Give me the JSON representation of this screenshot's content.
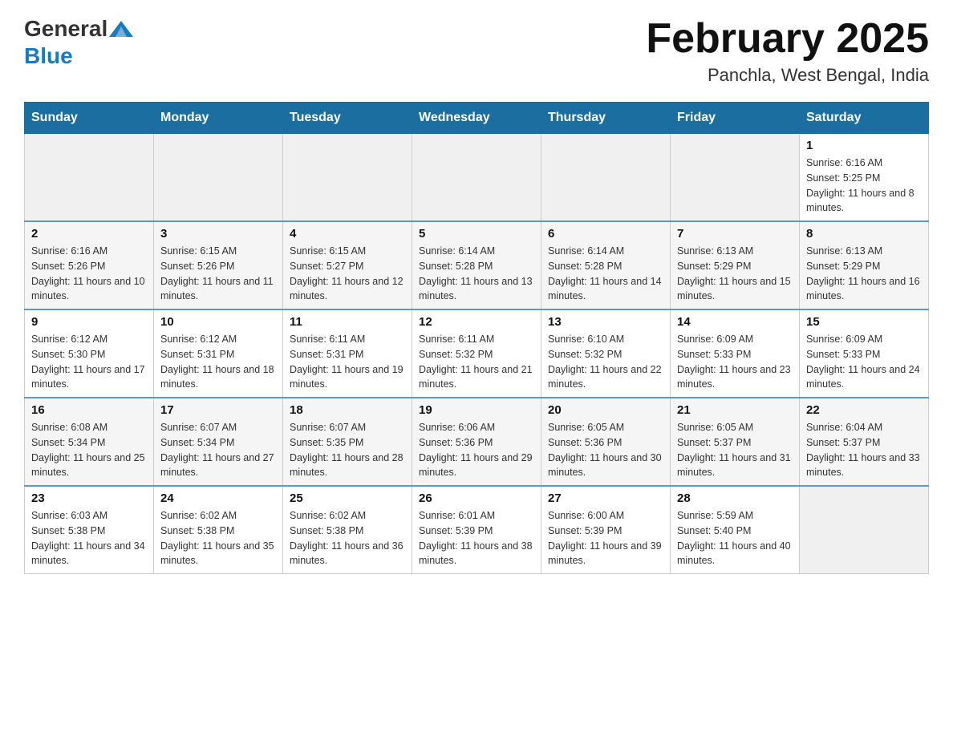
{
  "header": {
    "logo_general": "General",
    "logo_blue": "Blue",
    "month_title": "February 2025",
    "location": "Panchla, West Bengal, India"
  },
  "days_of_week": [
    "Sunday",
    "Monday",
    "Tuesday",
    "Wednesday",
    "Thursday",
    "Friday",
    "Saturday"
  ],
  "weeks": [
    [
      {
        "day": "",
        "info": ""
      },
      {
        "day": "",
        "info": ""
      },
      {
        "day": "",
        "info": ""
      },
      {
        "day": "",
        "info": ""
      },
      {
        "day": "",
        "info": ""
      },
      {
        "day": "",
        "info": ""
      },
      {
        "day": "1",
        "info": "Sunrise: 6:16 AM\nSunset: 5:25 PM\nDaylight: 11 hours and 8 minutes."
      }
    ],
    [
      {
        "day": "2",
        "info": "Sunrise: 6:16 AM\nSunset: 5:26 PM\nDaylight: 11 hours and 10 minutes."
      },
      {
        "day": "3",
        "info": "Sunrise: 6:15 AM\nSunset: 5:26 PM\nDaylight: 11 hours and 11 minutes."
      },
      {
        "day": "4",
        "info": "Sunrise: 6:15 AM\nSunset: 5:27 PM\nDaylight: 11 hours and 12 minutes."
      },
      {
        "day": "5",
        "info": "Sunrise: 6:14 AM\nSunset: 5:28 PM\nDaylight: 11 hours and 13 minutes."
      },
      {
        "day": "6",
        "info": "Sunrise: 6:14 AM\nSunset: 5:28 PM\nDaylight: 11 hours and 14 minutes."
      },
      {
        "day": "7",
        "info": "Sunrise: 6:13 AM\nSunset: 5:29 PM\nDaylight: 11 hours and 15 minutes."
      },
      {
        "day": "8",
        "info": "Sunrise: 6:13 AM\nSunset: 5:29 PM\nDaylight: 11 hours and 16 minutes."
      }
    ],
    [
      {
        "day": "9",
        "info": "Sunrise: 6:12 AM\nSunset: 5:30 PM\nDaylight: 11 hours and 17 minutes."
      },
      {
        "day": "10",
        "info": "Sunrise: 6:12 AM\nSunset: 5:31 PM\nDaylight: 11 hours and 18 minutes."
      },
      {
        "day": "11",
        "info": "Sunrise: 6:11 AM\nSunset: 5:31 PM\nDaylight: 11 hours and 19 minutes."
      },
      {
        "day": "12",
        "info": "Sunrise: 6:11 AM\nSunset: 5:32 PM\nDaylight: 11 hours and 21 minutes."
      },
      {
        "day": "13",
        "info": "Sunrise: 6:10 AM\nSunset: 5:32 PM\nDaylight: 11 hours and 22 minutes."
      },
      {
        "day": "14",
        "info": "Sunrise: 6:09 AM\nSunset: 5:33 PM\nDaylight: 11 hours and 23 minutes."
      },
      {
        "day": "15",
        "info": "Sunrise: 6:09 AM\nSunset: 5:33 PM\nDaylight: 11 hours and 24 minutes."
      }
    ],
    [
      {
        "day": "16",
        "info": "Sunrise: 6:08 AM\nSunset: 5:34 PM\nDaylight: 11 hours and 25 minutes."
      },
      {
        "day": "17",
        "info": "Sunrise: 6:07 AM\nSunset: 5:34 PM\nDaylight: 11 hours and 27 minutes."
      },
      {
        "day": "18",
        "info": "Sunrise: 6:07 AM\nSunset: 5:35 PM\nDaylight: 11 hours and 28 minutes."
      },
      {
        "day": "19",
        "info": "Sunrise: 6:06 AM\nSunset: 5:36 PM\nDaylight: 11 hours and 29 minutes."
      },
      {
        "day": "20",
        "info": "Sunrise: 6:05 AM\nSunset: 5:36 PM\nDaylight: 11 hours and 30 minutes."
      },
      {
        "day": "21",
        "info": "Sunrise: 6:05 AM\nSunset: 5:37 PM\nDaylight: 11 hours and 31 minutes."
      },
      {
        "day": "22",
        "info": "Sunrise: 6:04 AM\nSunset: 5:37 PM\nDaylight: 11 hours and 33 minutes."
      }
    ],
    [
      {
        "day": "23",
        "info": "Sunrise: 6:03 AM\nSunset: 5:38 PM\nDaylight: 11 hours and 34 minutes."
      },
      {
        "day": "24",
        "info": "Sunrise: 6:02 AM\nSunset: 5:38 PM\nDaylight: 11 hours and 35 minutes."
      },
      {
        "day": "25",
        "info": "Sunrise: 6:02 AM\nSunset: 5:38 PM\nDaylight: 11 hours and 36 minutes."
      },
      {
        "day": "26",
        "info": "Sunrise: 6:01 AM\nSunset: 5:39 PM\nDaylight: 11 hours and 38 minutes."
      },
      {
        "day": "27",
        "info": "Sunrise: 6:00 AM\nSunset: 5:39 PM\nDaylight: 11 hours and 39 minutes."
      },
      {
        "day": "28",
        "info": "Sunrise: 5:59 AM\nSunset: 5:40 PM\nDaylight: 11 hours and 40 minutes."
      },
      {
        "day": "",
        "info": ""
      }
    ]
  ]
}
